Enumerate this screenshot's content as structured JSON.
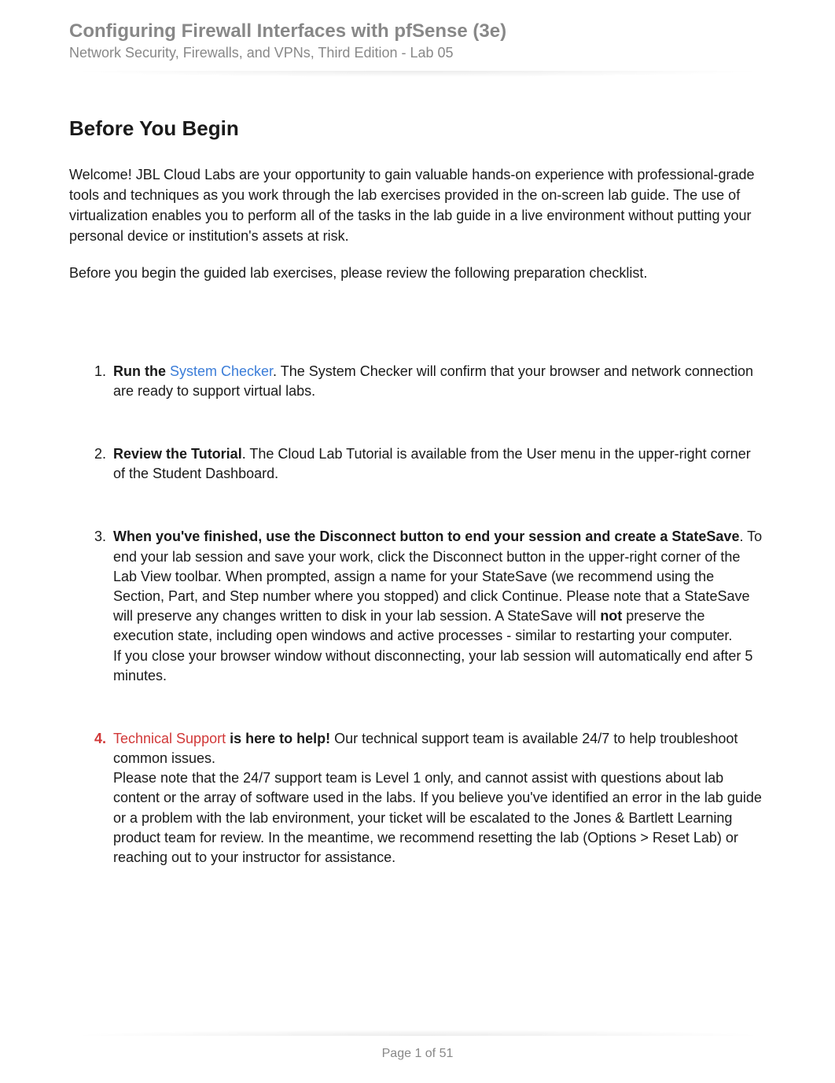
{
  "header": {
    "title": "Configuring Firewall Interfaces with pfSense (3e)",
    "subtitle": "Network Security, Firewalls, and VPNs, Third Edition - Lab 05"
  },
  "section": {
    "heading": "Before You Begin",
    "intro": "Welcome! JBL Cloud Labs are your opportunity to gain valuable hands-on experience with professional-grade tools and techniques as you work through the lab exercises provided in the on-screen lab guide. The use of virtualization enables you to perform all of the tasks in the lab guide in a live environment without putting your personal device or institution's assets at risk.",
    "checklist_intro": "Before you begin the guided lab exercises, please review the following preparation checklist."
  },
  "items": [
    {
      "number": "1.",
      "bold_prefix": "Run the ",
      "link_text": "System Checker",
      "after_link": ". The System Checker will confirm that your browser and network connection are ready to support virtual labs."
    },
    {
      "number": "2.",
      "bold_prefix": "Review the Tutorial",
      "after_bold": ". The Cloud Lab Tutorial is available from the User menu in the upper-right corner of the Student Dashboard."
    },
    {
      "number": "3.",
      "bold_prefix": "When you've finished, use the Disconnect button to end your session and create a StateSave",
      "after_bold_1": ". To end your lab session and save your work, click the Disconnect button in the upper-right corner of the Lab View toolbar. When prompted, assign a name for your StateSave (we recommend using the Section, Part, and Step number where you stopped) and click Continue. Please note that a StateSave will preserve any changes written to disk in your lab session. A StateSave will ",
      "bold_not": "not",
      "after_bold_2": " preserve the execution state, including open windows and active processes - similar to restarting your computer.",
      "para2": "If you close your browser window without disconnecting, your lab session will automatically end after 5 minutes."
    },
    {
      "number": "4.",
      "link_text": "Technical Support",
      "bold_after_link": " is here to help!",
      "after_bold_1": " Our technical support team is available 24/7 to help troubleshoot common issues.",
      "para2": "Please note that the 24/7 support team is Level 1 only, and cannot assist with questions about lab content or the array of software used in the labs. If you believe you've identified an error in the lab guide or a problem with the lab environment, your ticket will be escalated to the Jones & Bartlett Learning product team for review. In the meantime, we recommend resetting the lab (Options > Reset Lab) or reaching out to your instructor for assistance."
    }
  ],
  "footer": {
    "page_label": "Page 1 of 51"
  }
}
